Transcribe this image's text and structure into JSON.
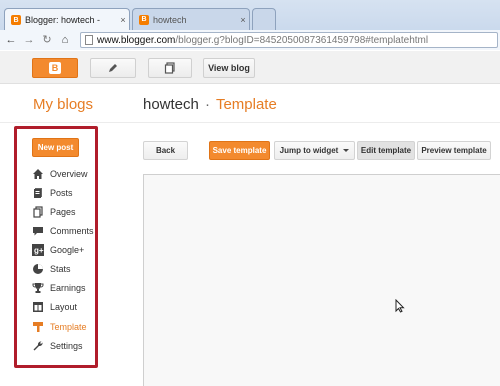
{
  "browser": {
    "tabs": [
      {
        "title": "Blogger: howtech -",
        "active": true
      },
      {
        "title": "howtech",
        "active": false
      }
    ],
    "url_host": "www.blogger.com",
    "url_rest": "/blogger.g?blogID=8452050087361459798#templatehtml"
  },
  "topbar": {
    "view_blog_label": "View blog"
  },
  "header": {
    "my_blogs": "My blogs",
    "blog_name": "howtech",
    "separator": "·",
    "section": "Template"
  },
  "sidebar": {
    "new_post_label": "New post",
    "items": [
      {
        "label": "Overview",
        "icon": "home-icon"
      },
      {
        "label": "Posts",
        "icon": "posts-icon"
      },
      {
        "label": "Pages",
        "icon": "pages-icon"
      },
      {
        "label": "Comments",
        "icon": "comments-icon"
      },
      {
        "label": "Google+",
        "icon": "google-plus-icon"
      },
      {
        "label": "Stats",
        "icon": "stats-icon"
      },
      {
        "label": "Earnings",
        "icon": "trophy-icon"
      },
      {
        "label": "Layout",
        "icon": "layout-icon"
      },
      {
        "label": "Template",
        "icon": "template-icon",
        "active": true
      },
      {
        "label": "Settings",
        "icon": "wrench-icon"
      }
    ],
    "highlight_color": "#b01d2b"
  },
  "template_toolbar": {
    "back_label": "Back",
    "save_label": "Save template",
    "jump_label": "Jump to widget",
    "edit_label": "Edit template",
    "preview_label": "Preview template"
  },
  "colors": {
    "accent": "#f38a2e",
    "accent_text": "#e67d24"
  }
}
